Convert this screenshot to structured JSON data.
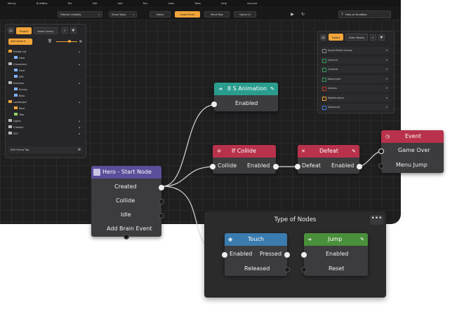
{
  "menu": [
    "Money",
    "BuildBox",
    "File",
    "Edit",
    "Add",
    "Run",
    "View",
    "Tools",
    "Help",
    "Account"
  ],
  "toolbar": {
    "visibility_select": "Filtered Visibility",
    "tasks_select": "Show Tasks",
    "mode_buttons": [
      "Editor",
      "Node Panel",
      "Mind Map",
      "Game UI"
    ],
    "active_mode": "Node Panel",
    "help_label": "Help on BuildBox"
  },
  "left_panel": {
    "tabs": [
      "Project",
      "Asset Library"
    ],
    "add_asset": "Add Asset",
    "tree": [
      {
        "label": "Prefab List",
        "indent": 0,
        "color": "#f1a53a"
      },
      {
        "label": "Hero",
        "indent": 1,
        "color": "#7fb3ff"
      },
      {
        "label": "Characters",
        "indent": 0,
        "color": "#bbbbbb"
      },
      {
        "label": "Hero",
        "indent": 1,
        "color": "#7fb3ff"
      },
      {
        "label": "NPC",
        "indent": 1,
        "color": "#7fb3ff"
      },
      {
        "label": "Enemies",
        "indent": 0,
        "color": "#bbbbbb"
      },
      {
        "label": "Enemy",
        "indent": 1,
        "color": "#7fb3ff"
      },
      {
        "label": "Boss",
        "indent": 1,
        "color": "#7fb3ff"
      },
      {
        "label": "Landscape",
        "indent": 0,
        "color": "#f1a53a"
      },
      {
        "label": "Rock",
        "indent": 1,
        "color": "#f1a53a"
      },
      {
        "label": "Tree",
        "indent": 1,
        "color": "#8ed06a"
      },
      {
        "label": "Lights",
        "indent": 0,
        "color": "#bbbbbb"
      },
      {
        "label": "Cutsene",
        "indent": 0,
        "color": "#bbbbbb"
      },
      {
        "label": "SFX",
        "indent": 0,
        "color": "#bbbbbb"
      }
    ],
    "group_tag": "Add Group Tag"
  },
  "right_panel": {
    "tabs": [
      "Nodes",
      "Brain Nexus"
    ],
    "items": [
      {
        "label": "Saved Node Groups",
        "color": "#888888"
      },
      {
        "label": "General",
        "color": "#2fa05b"
      },
      {
        "label": "Controls",
        "color": "#2fa05b"
      },
      {
        "label": "Movement",
        "color": "#2fa05b"
      },
      {
        "label": "Actions",
        "color": "#c0392b"
      },
      {
        "label": "Modifications",
        "color": "#f1a53a"
      },
      {
        "label": "Advanced",
        "color": "#3a7bd5"
      }
    ]
  },
  "nodes": {
    "animation": {
      "title": "8 S Animation",
      "row": "Enabled",
      "color": "#2a9d8f"
    },
    "collide": {
      "title": "If Collide",
      "in": "Collide",
      "out": "Enabled",
      "color": "#b8324b"
    },
    "defeat": {
      "title": "Defeat",
      "in": "Defeat",
      "out": "Enabled",
      "color": "#b8324b"
    },
    "event": {
      "title": "Event",
      "rows": [
        "Game Over",
        "Menu Jump"
      ],
      "color": "#b8324b"
    },
    "hero": {
      "title": "Hero - Start Node",
      "rows": [
        "Created",
        "Collide",
        "Idle",
        "Add Brain Event"
      ],
      "color": "#5b4e9a"
    },
    "touch": {
      "title": "Touch",
      "in": "Enabled",
      "out": "Pressed",
      "row2": "Released",
      "color": "#3a7bb0"
    },
    "jump": {
      "title": "Jump",
      "rows": [
        "Enabled",
        "Reset"
      ],
      "color": "#4a8f3a"
    }
  },
  "type_box": {
    "title": "Type of Nodes",
    "more": "•••"
  }
}
